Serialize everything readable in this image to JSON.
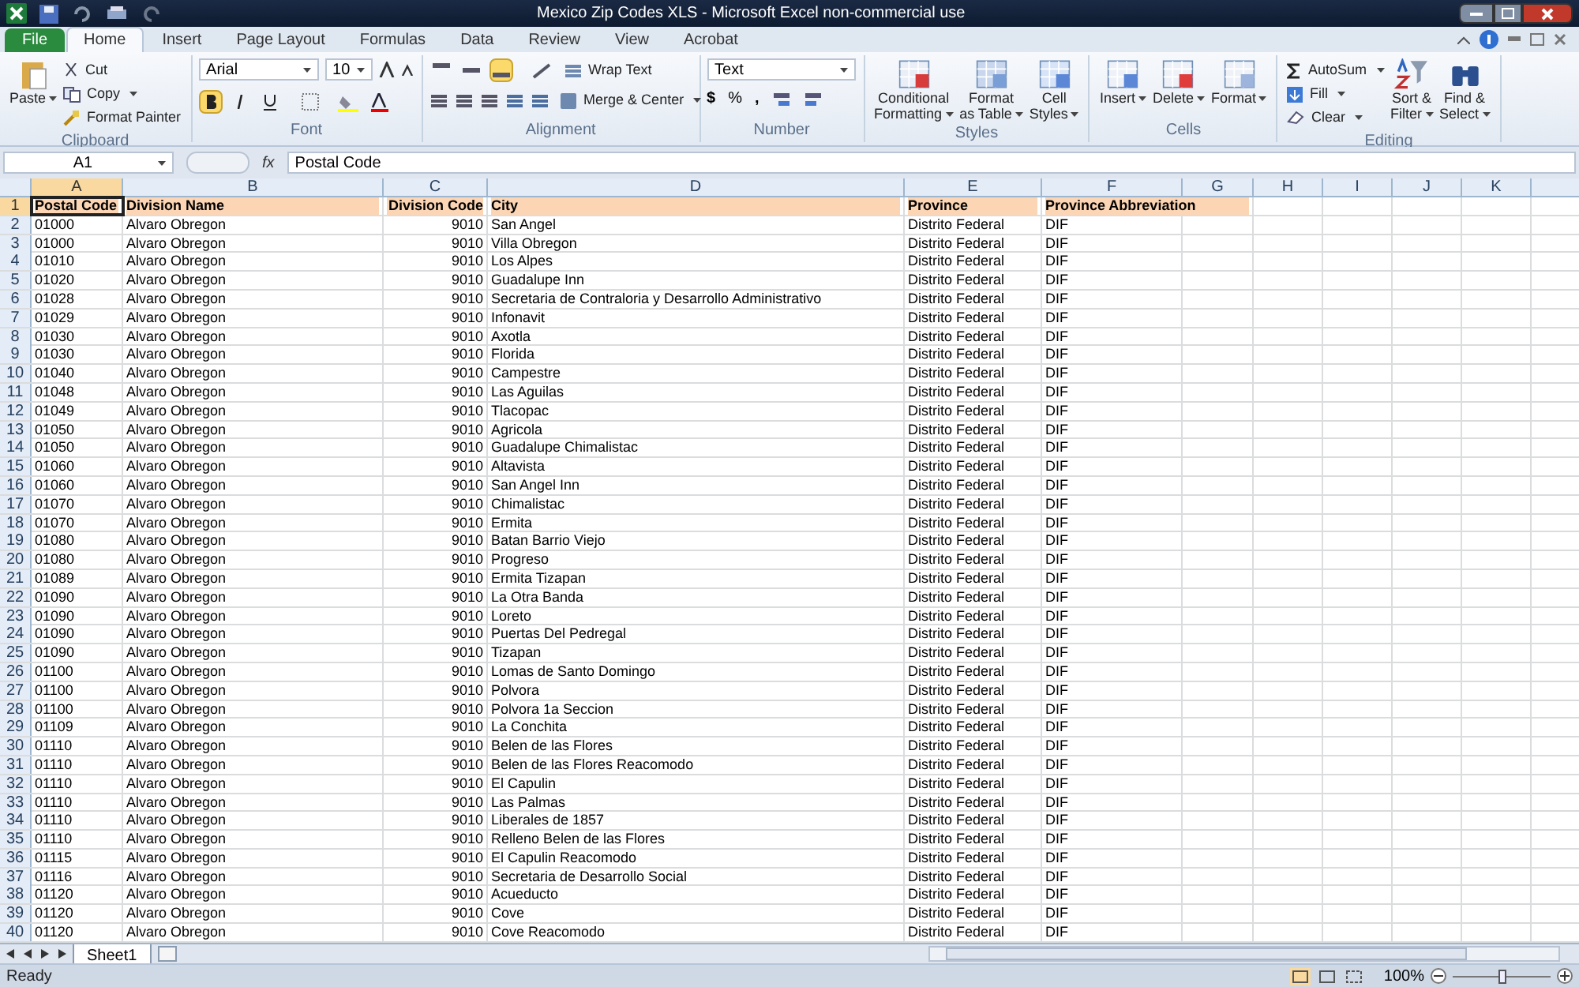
{
  "window": {
    "title": "Mexico Zip Codes XLS  -  Microsoft Excel non-commercial use"
  },
  "tabs": [
    {
      "label": "File",
      "kind": "file",
      "selected": false
    },
    {
      "label": "Home",
      "kind": "tab",
      "selected": true
    },
    {
      "label": "Insert",
      "kind": "tab",
      "selected": false
    },
    {
      "label": "Page Layout",
      "kind": "tab",
      "selected": false
    },
    {
      "label": "Formulas",
      "kind": "tab",
      "selected": false
    },
    {
      "label": "Data",
      "kind": "tab",
      "selected": false
    },
    {
      "label": "Review",
      "kind": "tab",
      "selected": false
    },
    {
      "label": "View",
      "kind": "tab",
      "selected": false
    },
    {
      "label": "Acrobat",
      "kind": "tab",
      "selected": false
    }
  ],
  "clipboard": {
    "name": "Clipboard",
    "paste": "Paste",
    "cut": "Cut",
    "copy": "Copy",
    "painter": "Format Painter"
  },
  "font": {
    "name": "Font",
    "family": "Arial",
    "size": "10",
    "bold": true,
    "italic": false,
    "underline": false
  },
  "alignment": {
    "name": "Alignment",
    "wrap": "Wrap Text",
    "merge": "Merge & Center",
    "valign": [
      {
        "selected": false
      },
      {
        "selected": false
      },
      {
        "selected": true
      }
    ]
  },
  "number": {
    "name": "Number",
    "format": "Text",
    "currency": "$",
    "percent": "%",
    "comma": ","
  },
  "styles": {
    "name": "Styles",
    "buttons": [
      [
        "Conditional",
        "Formatting"
      ],
      [
        "Format",
        "as Table"
      ],
      [
        "Cell",
        "Styles"
      ]
    ]
  },
  "cells": {
    "name": "Cells",
    "buttons": [
      "Insert",
      "Delete",
      "Format"
    ]
  },
  "editing": {
    "name": "Editing",
    "autosum": "AutoSum",
    "fill": "Fill",
    "clear": "Clear",
    "sort": [
      "Sort &",
      "Filter"
    ],
    "find": [
      "Find &",
      "Select"
    ]
  },
  "formula_bar": {
    "name_box": "A1",
    "fx": "fx",
    "value": "Postal Code"
  },
  "columns": [
    {
      "label": "A",
      "selected": true
    },
    {
      "label": "B",
      "selected": false
    },
    {
      "label": "C",
      "selected": false
    },
    {
      "label": "D",
      "selected": false
    },
    {
      "label": "E",
      "selected": false
    },
    {
      "label": "F",
      "selected": false
    },
    {
      "label": "G",
      "selected": false
    },
    {
      "label": "H",
      "selected": false
    },
    {
      "label": "I",
      "selected": false
    },
    {
      "label": "J",
      "selected": false
    },
    {
      "label": "K",
      "selected": false
    }
  ],
  "rows": [
    {
      "n": "1",
      "header": true,
      "selected": true,
      "cells": [
        "Postal Code",
        "Division Name",
        "Division Code",
        "City",
        "Province",
        "Province Abbreviation"
      ]
    },
    {
      "n": "2",
      "header": false,
      "selected": false,
      "cells": [
        "01000",
        "Alvaro Obregon",
        "9010",
        "San Angel",
        "Distrito Federal",
        "DIF"
      ]
    },
    {
      "n": "3",
      "header": false,
      "selected": false,
      "cells": [
        "01000",
        "Alvaro Obregon",
        "9010",
        "Villa Obregon",
        "Distrito Federal",
        "DIF"
      ]
    },
    {
      "n": "4",
      "header": false,
      "selected": false,
      "cells": [
        "01010",
        "Alvaro Obregon",
        "9010",
        "Los Alpes",
        "Distrito Federal",
        "DIF"
      ]
    },
    {
      "n": "5",
      "header": false,
      "selected": false,
      "cells": [
        "01020",
        "Alvaro Obregon",
        "9010",
        "Guadalupe Inn",
        "Distrito Federal",
        "DIF"
      ]
    },
    {
      "n": "6",
      "header": false,
      "selected": false,
      "cells": [
        "01028",
        "Alvaro Obregon",
        "9010",
        "Secretaria de Contraloria y Desarrollo Administrativo",
        "Distrito Federal",
        "DIF"
      ]
    },
    {
      "n": "7",
      "header": false,
      "selected": false,
      "cells": [
        "01029",
        "Alvaro Obregon",
        "9010",
        "Infonavit",
        "Distrito Federal",
        "DIF"
      ]
    },
    {
      "n": "8",
      "header": false,
      "selected": false,
      "cells": [
        "01030",
        "Alvaro Obregon",
        "9010",
        "Axotla",
        "Distrito Federal",
        "DIF"
      ]
    },
    {
      "n": "9",
      "header": false,
      "selected": false,
      "cells": [
        "01030",
        "Alvaro Obregon",
        "9010",
        "Florida",
        "Distrito Federal",
        "DIF"
      ]
    },
    {
      "n": "10",
      "header": false,
      "selected": false,
      "cells": [
        "01040",
        "Alvaro Obregon",
        "9010",
        "Campestre",
        "Distrito Federal",
        "DIF"
      ]
    },
    {
      "n": "11",
      "header": false,
      "selected": false,
      "cells": [
        "01048",
        "Alvaro Obregon",
        "9010",
        "Las Aguilas",
        "Distrito Federal",
        "DIF"
      ]
    },
    {
      "n": "12",
      "header": false,
      "selected": false,
      "cells": [
        "01049",
        "Alvaro Obregon",
        "9010",
        "Tlacopac",
        "Distrito Federal",
        "DIF"
      ]
    },
    {
      "n": "13",
      "header": false,
      "selected": false,
      "cells": [
        "01050",
        "Alvaro Obregon",
        "9010",
        "Agricola",
        "Distrito Federal",
        "DIF"
      ]
    },
    {
      "n": "14",
      "header": false,
      "selected": false,
      "cells": [
        "01050",
        "Alvaro Obregon",
        "9010",
        "Guadalupe Chimalistac",
        "Distrito Federal",
        "DIF"
      ]
    },
    {
      "n": "15",
      "header": false,
      "selected": false,
      "cells": [
        "01060",
        "Alvaro Obregon",
        "9010",
        "Altavista",
        "Distrito Federal",
        "DIF"
      ]
    },
    {
      "n": "16",
      "header": false,
      "selected": false,
      "cells": [
        "01060",
        "Alvaro Obregon",
        "9010",
        "San Angel Inn",
        "Distrito Federal",
        "DIF"
      ]
    },
    {
      "n": "17",
      "header": false,
      "selected": false,
      "cells": [
        "01070",
        "Alvaro Obregon",
        "9010",
        "Chimalistac",
        "Distrito Federal",
        "DIF"
      ]
    },
    {
      "n": "18",
      "header": false,
      "selected": false,
      "cells": [
        "01070",
        "Alvaro Obregon",
        "9010",
        "Ermita",
        "Distrito Federal",
        "DIF"
      ]
    },
    {
      "n": "19",
      "header": false,
      "selected": false,
      "cells": [
        "01080",
        "Alvaro Obregon",
        "9010",
        "Batan Barrio Viejo",
        "Distrito Federal",
        "DIF"
      ]
    },
    {
      "n": "20",
      "header": false,
      "selected": false,
      "cells": [
        "01080",
        "Alvaro Obregon",
        "9010",
        "Progreso",
        "Distrito Federal",
        "DIF"
      ]
    },
    {
      "n": "21",
      "header": false,
      "selected": false,
      "cells": [
        "01089",
        "Alvaro Obregon",
        "9010",
        "Ermita Tizapan",
        "Distrito Federal",
        "DIF"
      ]
    },
    {
      "n": "22",
      "header": false,
      "selected": false,
      "cells": [
        "01090",
        "Alvaro Obregon",
        "9010",
        "La Otra Banda",
        "Distrito Federal",
        "DIF"
      ]
    },
    {
      "n": "23",
      "header": false,
      "selected": false,
      "cells": [
        "01090",
        "Alvaro Obregon",
        "9010",
        "Loreto",
        "Distrito Federal",
        "DIF"
      ]
    },
    {
      "n": "24",
      "header": false,
      "selected": false,
      "cells": [
        "01090",
        "Alvaro Obregon",
        "9010",
        "Puertas Del Pedregal",
        "Distrito Federal",
        "DIF"
      ]
    },
    {
      "n": "25",
      "header": false,
      "selected": false,
      "cells": [
        "01090",
        "Alvaro Obregon",
        "9010",
        "Tizapan",
        "Distrito Federal",
        "DIF"
      ]
    },
    {
      "n": "26",
      "header": false,
      "selected": false,
      "cells": [
        "01100",
        "Alvaro Obregon",
        "9010",
        "Lomas de Santo Domingo",
        "Distrito Federal",
        "DIF"
      ]
    },
    {
      "n": "27",
      "header": false,
      "selected": false,
      "cells": [
        "01100",
        "Alvaro Obregon",
        "9010",
        "Polvora",
        "Distrito Federal",
        "DIF"
      ]
    },
    {
      "n": "28",
      "header": false,
      "selected": false,
      "cells": [
        "01100",
        "Alvaro Obregon",
        "9010",
        "Polvora 1a Seccion",
        "Distrito Federal",
        "DIF"
      ]
    },
    {
      "n": "29",
      "header": false,
      "selected": false,
      "cells": [
        "01109",
        "Alvaro Obregon",
        "9010",
        "La Conchita",
        "Distrito Federal",
        "DIF"
      ]
    },
    {
      "n": "30",
      "header": false,
      "selected": false,
      "cells": [
        "01110",
        "Alvaro Obregon",
        "9010",
        "Belen de las Flores",
        "Distrito Federal",
        "DIF"
      ]
    },
    {
      "n": "31",
      "header": false,
      "selected": false,
      "cells": [
        "01110",
        "Alvaro Obregon",
        "9010",
        "Belen de las Flores Reacomodo",
        "Distrito Federal",
        "DIF"
      ]
    },
    {
      "n": "32",
      "header": false,
      "selected": false,
      "cells": [
        "01110",
        "Alvaro Obregon",
        "9010",
        "El Capulin",
        "Distrito Federal",
        "DIF"
      ]
    },
    {
      "n": "33",
      "header": false,
      "selected": false,
      "cells": [
        "01110",
        "Alvaro Obregon",
        "9010",
        "Las Palmas",
        "Distrito Federal",
        "DIF"
      ]
    },
    {
      "n": "34",
      "header": false,
      "selected": false,
      "cells": [
        "01110",
        "Alvaro Obregon",
        "9010",
        "Liberales de 1857",
        "Distrito Federal",
        "DIF"
      ]
    },
    {
      "n": "35",
      "header": false,
      "selected": false,
      "cells": [
        "01110",
        "Alvaro Obregon",
        "9010",
        "Relleno Belen de las Flores",
        "Distrito Federal",
        "DIF"
      ]
    },
    {
      "n": "36",
      "header": false,
      "selected": false,
      "cells": [
        "01115",
        "Alvaro Obregon",
        "9010",
        "El Capulin Reacomodo",
        "Distrito Federal",
        "DIF"
      ]
    },
    {
      "n": "37",
      "header": false,
      "selected": false,
      "cells": [
        "01116",
        "Alvaro Obregon",
        "9010",
        "Secretaria de Desarrollo Social",
        "Distrito Federal",
        "DIF"
      ]
    },
    {
      "n": "38",
      "header": false,
      "selected": false,
      "cells": [
        "01120",
        "Alvaro Obregon",
        "9010",
        "Acueducto",
        "Distrito Federal",
        "DIF"
      ]
    },
    {
      "n": "39",
      "header": false,
      "selected": false,
      "cells": [
        "01120",
        "Alvaro Obregon",
        "9010",
        "Cove",
        "Distrito Federal",
        "DIF"
      ]
    },
    {
      "n": "40",
      "header": false,
      "selected": false,
      "cells": [
        "01120",
        "Alvaro Obregon",
        "9010",
        "Cove Reacomodo",
        "Distrito Federal",
        "DIF"
      ]
    }
  ],
  "sheet_tabs": [
    {
      "label": "Sheet1",
      "selected": true
    }
  ],
  "status_bar": {
    "status": "Ready",
    "zoom": "100%",
    "zoom_slider": {
      "level": 0.5
    }
  }
}
